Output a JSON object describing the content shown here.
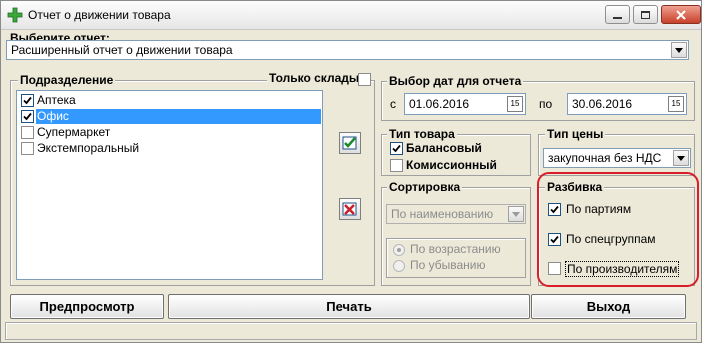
{
  "window": {
    "title": "Отчет о движении товара"
  },
  "report": {
    "label": "Выберите отчет:",
    "selected": "Расширенный отчет о движении товара"
  },
  "departments": {
    "title": "Подразделение",
    "only_warehouses_label": "Только склады",
    "items": [
      {
        "label": "Аптека",
        "checked": true,
        "selected": false
      },
      {
        "label": "Офис",
        "checked": true,
        "selected": true
      },
      {
        "label": "Супермаркет",
        "checked": false,
        "selected": false
      },
      {
        "label": "Экстемпоральный",
        "checked": false,
        "selected": false
      }
    ]
  },
  "dates": {
    "title": "Выбор дат для отчета",
    "from_label": "с",
    "from_value": "01.06.2016",
    "to_label": "по",
    "to_value": "30.06.2016",
    "calendar_glyph": "15"
  },
  "goods_type": {
    "title": "Тип товара",
    "balance_label": "Балансовый",
    "balance_checked": true,
    "commission_label": "Комиссионный",
    "commission_checked": false
  },
  "price_type": {
    "title": "Тип цены",
    "selected": "закупочная без НДС"
  },
  "sorting": {
    "title": "Сортировка",
    "selected": "По наименованию",
    "asc_label": "По возрастанию",
    "desc_label": "По убыванию"
  },
  "breakdown": {
    "title": "Разбивка",
    "by_batches_label": "По партиям",
    "by_batches_checked": true,
    "by_special_groups_label": "По спецгруппам",
    "by_special_groups_checked": true,
    "by_manufacturers_label": "По производителям",
    "by_manufacturers_checked": false
  },
  "buttons": {
    "preview": "Предпросмотр",
    "print": "Печать",
    "exit": "Выход"
  },
  "colors": {
    "highlight_ring": "#d81e2a",
    "selection": "#3399ff",
    "app_icon": "#3aa83a"
  }
}
